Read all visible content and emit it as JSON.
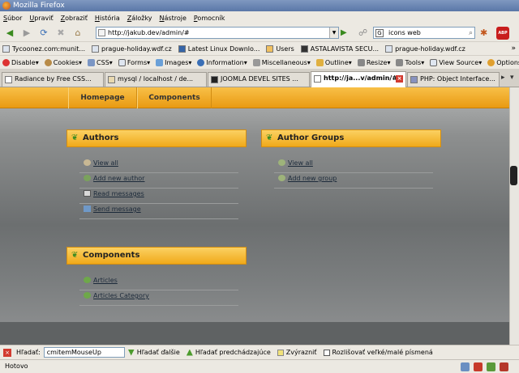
{
  "window": {
    "title": "Mozilla Firefox"
  },
  "menu": [
    "Súbor",
    "Upraviť",
    "Zobraziť",
    "História",
    "Záložky",
    "Nástroje",
    "Pomocník"
  ],
  "nav": {
    "url": "http://jakub.dev/admin/#",
    "search_value": "icons web",
    "search_engine_glyph": "G",
    "adblock_label": "ABP"
  },
  "bookmarks": [
    "Tycoonez.com:munit...",
    "prague-holiday.wdf.cz",
    "Latest Linux Downlo...",
    "Users",
    "ASTALAVISTA SECU...",
    "prague-holiday.wdf.cz"
  ],
  "bookmarks_overflow": "»",
  "devtoolbar": [
    "Disable",
    "Cookies",
    "CSS",
    "Forms",
    "Images",
    "Information",
    "Miscellaneous",
    "Outline",
    "Resize",
    "Tools",
    "View Source",
    "Options"
  ],
  "tabs": [
    {
      "label": "Radiance by Free CSS..."
    },
    {
      "label": "mysql / localhost / de..."
    },
    {
      "label": "JOOMLA DEVEL SITES ..."
    },
    {
      "label": "http://ja...v/admin/#"
    },
    {
      "label": "PHP: Object Interface..."
    }
  ],
  "site": {
    "nav": [
      "Homepage",
      "Components"
    ],
    "authors": {
      "title": "Authors",
      "links": [
        "View all",
        "Add new author",
        "Read messages",
        "Send message"
      ]
    },
    "author_groups": {
      "title": "Author Groups",
      "links": [
        "View all",
        "Add new group"
      ]
    },
    "components": {
      "title": "Components",
      "links": [
        "Articles",
        "Articles Category"
      ]
    }
  },
  "findbar": {
    "label": "Hľadať:",
    "value": "cmitemMouseUp",
    "next": "Hľadať ďalšie",
    "prev": "Hľadať predchádzajúce",
    "highlight": "Zvýrazniť",
    "match_case": "Rozlišovať veľké/malé písmená"
  },
  "status": {
    "text": "Hotovo"
  }
}
